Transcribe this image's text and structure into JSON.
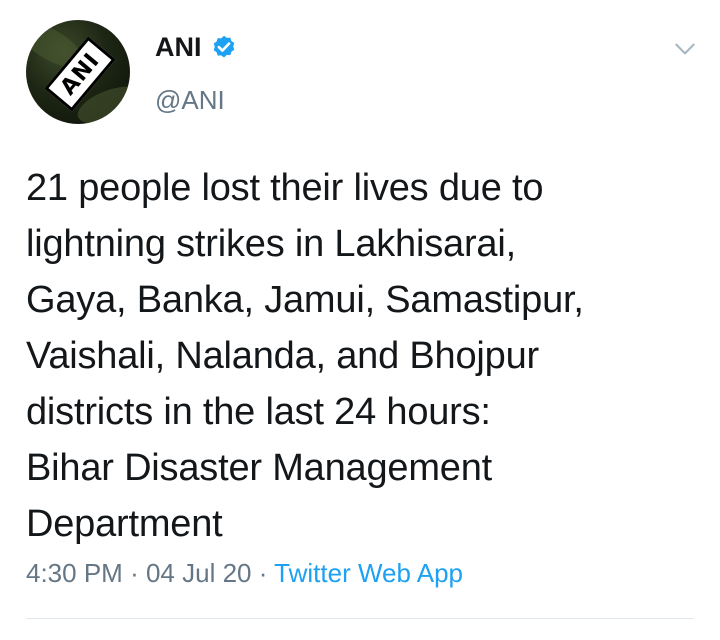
{
  "author": {
    "display_name": "ANI",
    "handle": "@ANI",
    "verified": true,
    "avatar_text": "ANI"
  },
  "tweet": {
    "text": "21 people lost their lives due to\nlightning strikes in Lakhisarai,\nGaya, Banka, Jamui, Samastipur,\nVaishali, Nalanda, and Bhojpur\ndistricts in the last 24 hours:\nBihar Disaster Management\nDepartment",
    "time": "4:30 PM",
    "date": "04 Jul 20",
    "source": "Twitter Web App",
    "separator": "·"
  },
  "icons": {
    "verified": "verified-badge-icon",
    "menu": "chevron-down-icon"
  },
  "colors": {
    "text": "#14171a",
    "secondary": "#657786",
    "accent": "#1da1f2",
    "divider": "#e1e8ed"
  }
}
